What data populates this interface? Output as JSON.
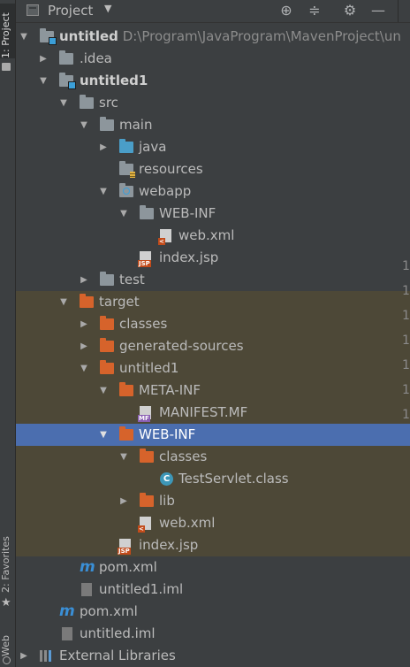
{
  "tool_strip": {
    "project_tab": "1: Project",
    "favorites_tab": "2: Favorites",
    "web_tab": "Web"
  },
  "header": {
    "title": "Project",
    "dropdown_icon": "caret-down-icon",
    "actions": [
      "locate-icon",
      "collapse-all-icon",
      "gear-icon",
      "minimize-icon"
    ]
  },
  "colors": {
    "selection": "#4b6eaf",
    "excluded_background": "#4d4837",
    "folder_gray": "#8d969c",
    "folder_orange": "#d6632b",
    "folder_blue": "#4a9ec8",
    "maven_blue": "#3a8fd6"
  },
  "tree": {
    "root": {
      "name": "untitled",
      "path": "D:\\Program\\JavaProgram\\MavenProject\\un"
    },
    "idea": ".idea",
    "module": "untitled1",
    "src": "src",
    "main": "main",
    "java": "java",
    "resources": "resources",
    "webapp": "webapp",
    "webinf_src": "WEB-INF",
    "webxml_src": "web.xml",
    "indexjsp_src": "index.jsp",
    "test": "test",
    "target": "target",
    "classes_target": "classes",
    "generated_sources": "generated-sources",
    "untitled1_out": "untitled1",
    "meta_inf": "META-INF",
    "manifest": "MANIFEST.MF",
    "webinf_out": "WEB-INF",
    "classes_out": "classes",
    "servlet_class": "TestServlet.class",
    "lib": "lib",
    "webxml_out": "web.xml",
    "indexjsp_out": "index.jsp",
    "pom_module": "pom.xml",
    "iml_module": "untitled1.iml",
    "pom_root": "pom.xml",
    "iml_root": "untitled.iml",
    "external_libraries": "External Libraries"
  },
  "gutter_digit": "1"
}
